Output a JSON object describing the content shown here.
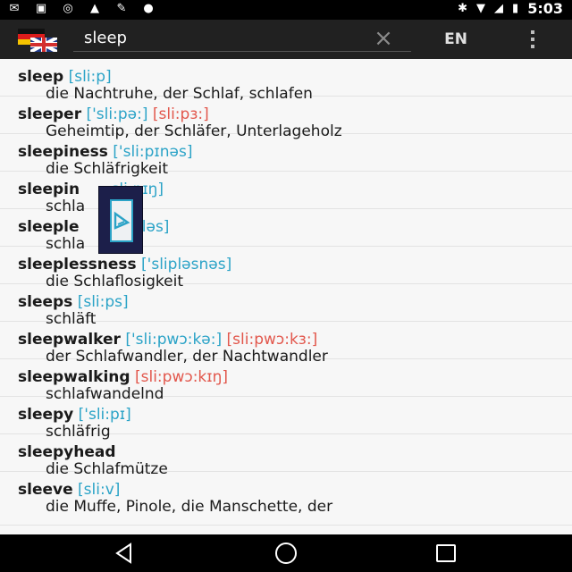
{
  "status_bar": {
    "time": "5:03",
    "left_icons": [
      "notification-icon",
      "flipboard-icon",
      "sync-icon",
      "lock-icon",
      "tools-icon",
      "android-icon"
    ],
    "right_icons": [
      "bluetooth-icon",
      "wifi-icon",
      "no-signal-icon",
      "battery-charging-icon"
    ]
  },
  "app_bar": {
    "search_value": "sleep",
    "language_button": "EN",
    "clear_icon": "×",
    "flag_icon": "de-uk-flag-icon",
    "menu_icon": "overflow-menu-icon"
  },
  "entries": [
    {
      "word": "sleep",
      "ipa1": "[sli:p]",
      "ipa2": "",
      "translation": "die Nachtruhe, der Schlaf, schlafen"
    },
    {
      "word": "sleeper",
      "ipa1": "['sli:pə:]",
      "ipa2": "[sli:pɜ:]",
      "translation": "Geheimtip, der Schläfer, Unterlageholz"
    },
    {
      "word": "sleepiness",
      "ipa1": "['sli:pɪnəs]",
      "ipa2": "",
      "translation": "die Schläfrigkeit"
    },
    {
      "word": "sleepin",
      "ipa1": "sli:pɪŋ]",
      "ipa2": "",
      "translation": "schla      d"
    },
    {
      "word": "sleeple",
      "ipa1": "sli:pləs]",
      "ipa2": "",
      "translation": "schla"
    },
    {
      "word": "sleeplessness",
      "ipa1": "['slipləsnəs]",
      "ipa2": "",
      "translation": "die Schlaflosigkeit"
    },
    {
      "word": "sleeps",
      "ipa1": "[sli:ps]",
      "ipa2": "",
      "translation": "schläft"
    },
    {
      "word": "sleepwalker",
      "ipa1": "['sli:pwɔ:kə:]",
      "ipa2": "[sli:pwɔ:kɜ:]",
      "translation": "der Schlafwandler, der Nachtwandler"
    },
    {
      "word": "sleepwalking",
      "ipa1": "",
      "ipa2": "[sli:pwɔ:kɪŋ]",
      "translation": "schlafwandelnd"
    },
    {
      "word": "sleepy",
      "ipa1": "['sli:pɪ]",
      "ipa2": "",
      "translation": "schläfrig"
    },
    {
      "word": "sleepyhead",
      "ipa1": "",
      "ipa2": "",
      "translation": "die Schlafmütze"
    },
    {
      "word": "sleeve",
      "ipa1": "[sli:v]",
      "ipa2": "",
      "translation": "die Muffe, Pinole, die Manschette, der"
    }
  ],
  "nav_bar": {
    "icons": [
      "back-icon",
      "home-icon",
      "recents-icon"
    ]
  }
}
